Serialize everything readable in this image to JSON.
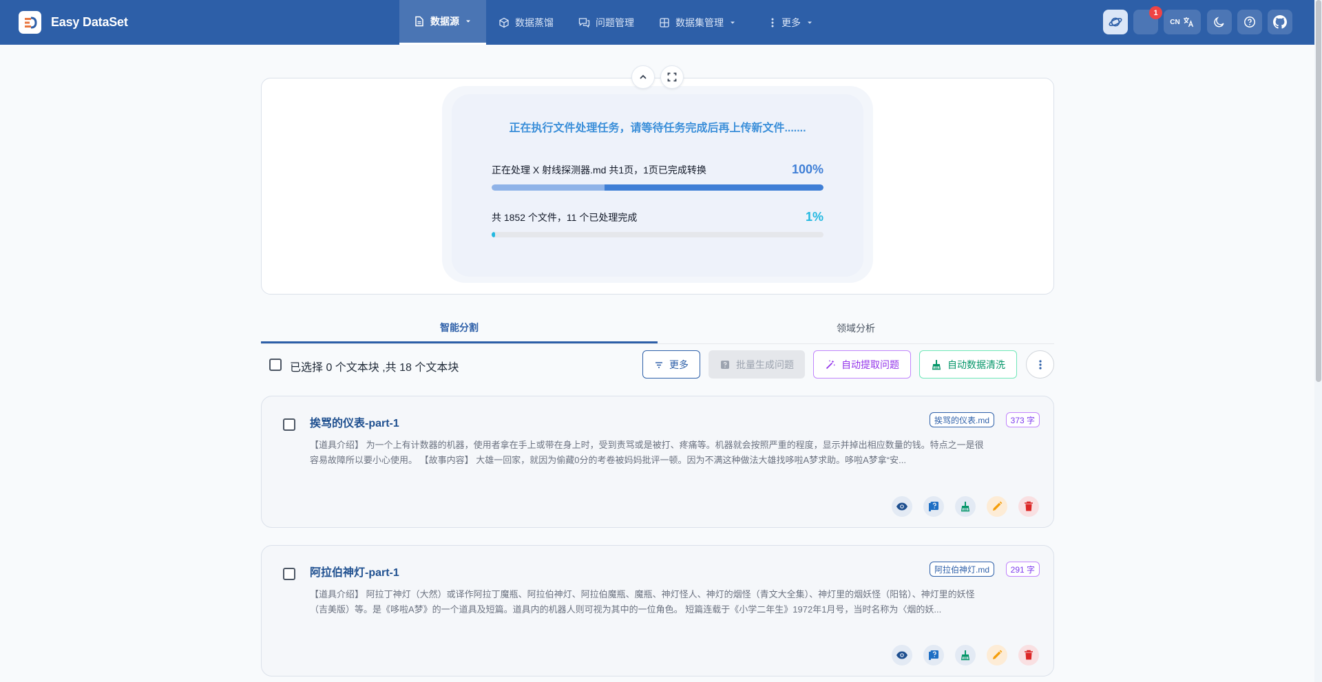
{
  "app": {
    "name": "Easy DataSet"
  },
  "nav": {
    "items": [
      {
        "label": "数据源",
        "icon": "file-icon",
        "active": true,
        "dropdown": true
      },
      {
        "label": "数据蒸馏",
        "icon": "cube-icon",
        "active": false,
        "dropdown": false
      },
      {
        "label": "问题管理",
        "icon": "chat-icon",
        "active": false,
        "dropdown": false
      },
      {
        "label": "数据集管理",
        "icon": "grid-icon",
        "active": false,
        "dropdown": true
      },
      {
        "label": "更多",
        "icon": "kebab-icon",
        "active": false,
        "dropdown": true
      }
    ]
  },
  "header_actions": {
    "notification_count": "1",
    "language_code": "CN"
  },
  "processing": {
    "title": "正在执行文件处理任务，请等待任务完成后再上传新文件.......",
    "current_label": "正在处理 X 射线探测器.md 共1页，1页已完成转换",
    "current_percent_text": "100%",
    "current_progress": 1.0,
    "total_label": "共 1852 个文件，11 个已处理完成",
    "total_percent_text": "1%",
    "total_progress": 0.01,
    "colors": {
      "current": "#3f7fd6",
      "current_light": "#8fb3e8",
      "total": "#22b8e0"
    }
  },
  "tabs": [
    {
      "label": "智能分割",
      "active": true
    },
    {
      "label": "领域分析",
      "active": false
    }
  ],
  "toolbar": {
    "selection_text": "已选择 0 个文本块 ,共 18 个文本块",
    "more_label": "更多",
    "batch_label": "批量生成问题",
    "extract_label": "自动提取问题",
    "clean_label": "自动数据清洗"
  },
  "chunks": [
    {
      "title": "挨骂的仪表-part-1",
      "file": "挨骂的仪表.md",
      "words": "373 字",
      "text_line1": "【道具介绍】 为一个上有计数器的机器，使用者拿在手上或带在身上时，受到责骂或是被打、疼痛等。机器就会按照严重的程度，显示并掉出相应数量的钱。特点之一是很",
      "text_line2": "容易故障所以要小心使用。 【故事内容】 大雄一回家，就因为偷藏0分的考卷被妈妈批评一顿。因为不满这种做法大雄找哆啦A梦求助。哆啦A梦拿“安..."
    },
    {
      "title": "阿拉伯神灯-part-1",
      "file": "阿拉伯神灯.md",
      "words": "291 字",
      "text_line1": "【道具介绍】 阿拉丁神灯（大然）或译作阿拉丁魔瓶、阿拉伯神灯、阿拉伯魔瓶、魔瓶、神灯怪人、神灯的烟怪（青文大全集）、神灯里的烟妖怪（阳铭）、神灯里的妖怪",
      "text_line2": "（吉美版）等。是《哆啦A梦》的一个道具及短篇。道具内的机器人则可视为其中的一位角色。 短篇连载于《小学二年生》1972年1月号，当时名称为〈烟的妖..."
    }
  ]
}
